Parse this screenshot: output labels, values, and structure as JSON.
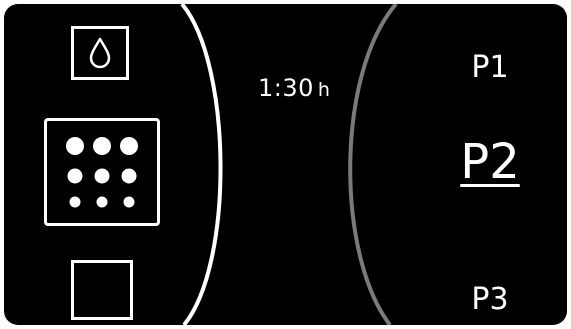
{
  "panel": {
    "background": "#000000",
    "foreground": "#ffffff",
    "right_arc_color": "#7a7a7a"
  },
  "left_buttons": [
    {
      "icon": "water-drop-icon"
    },
    {
      "icon": "dot-grid-icon"
    },
    {
      "icon": "blank-square-icon"
    }
  ],
  "duration": {
    "value": "1:30",
    "unit": "h"
  },
  "programs": [
    {
      "label": "P1",
      "selected": false
    },
    {
      "label": "P2",
      "selected": true
    },
    {
      "label": "P3",
      "selected": false
    }
  ]
}
